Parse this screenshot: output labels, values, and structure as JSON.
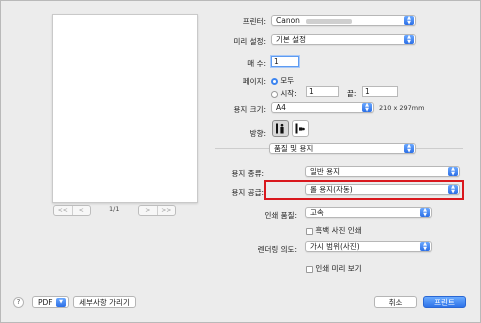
{
  "preview": {
    "page_counter": "1/1",
    "first_label": "<<",
    "prev_label": "<",
    "next_label": ">",
    "last_label": ">>"
  },
  "printer": {
    "label": "프린터:",
    "value": "Canon"
  },
  "presets": {
    "label": "미리 설정:",
    "value": "기본 설정"
  },
  "copies": {
    "label": "매 수:",
    "value": "1"
  },
  "pages": {
    "label": "페이지:",
    "all_label": "모두",
    "from_label": "시작:",
    "from_value": "1",
    "to_label": "끝:",
    "to_value": "1"
  },
  "paper_size": {
    "label": "용지 크기:",
    "value": "A4",
    "dimensions": "210 x 297mm"
  },
  "orientation": {
    "label": "방향:"
  },
  "section": {
    "value": "품질 및 용지"
  },
  "media_type": {
    "label": "용지 종류:",
    "value": "일반 용지"
  },
  "paper_source": {
    "label": "용지 공급:",
    "value": "롤 용지(자동)"
  },
  "print_quality": {
    "label": "인쇄 품질:",
    "value": "고속"
  },
  "grayscale": {
    "label": "흑백 사진 인쇄"
  },
  "rendering_intent": {
    "label": "렌더링 의도:",
    "value": "가시 범위(사진)"
  },
  "print_preview": {
    "label": "인쇄 미리 보기"
  },
  "footer": {
    "help": "?",
    "pdf_label": "PDF",
    "details_label": "세부사항 가리기",
    "cancel_label": "취소",
    "print_label": "프린트"
  },
  "colors": {
    "accent": "#2e73e8",
    "highlight": "#d9181e"
  }
}
